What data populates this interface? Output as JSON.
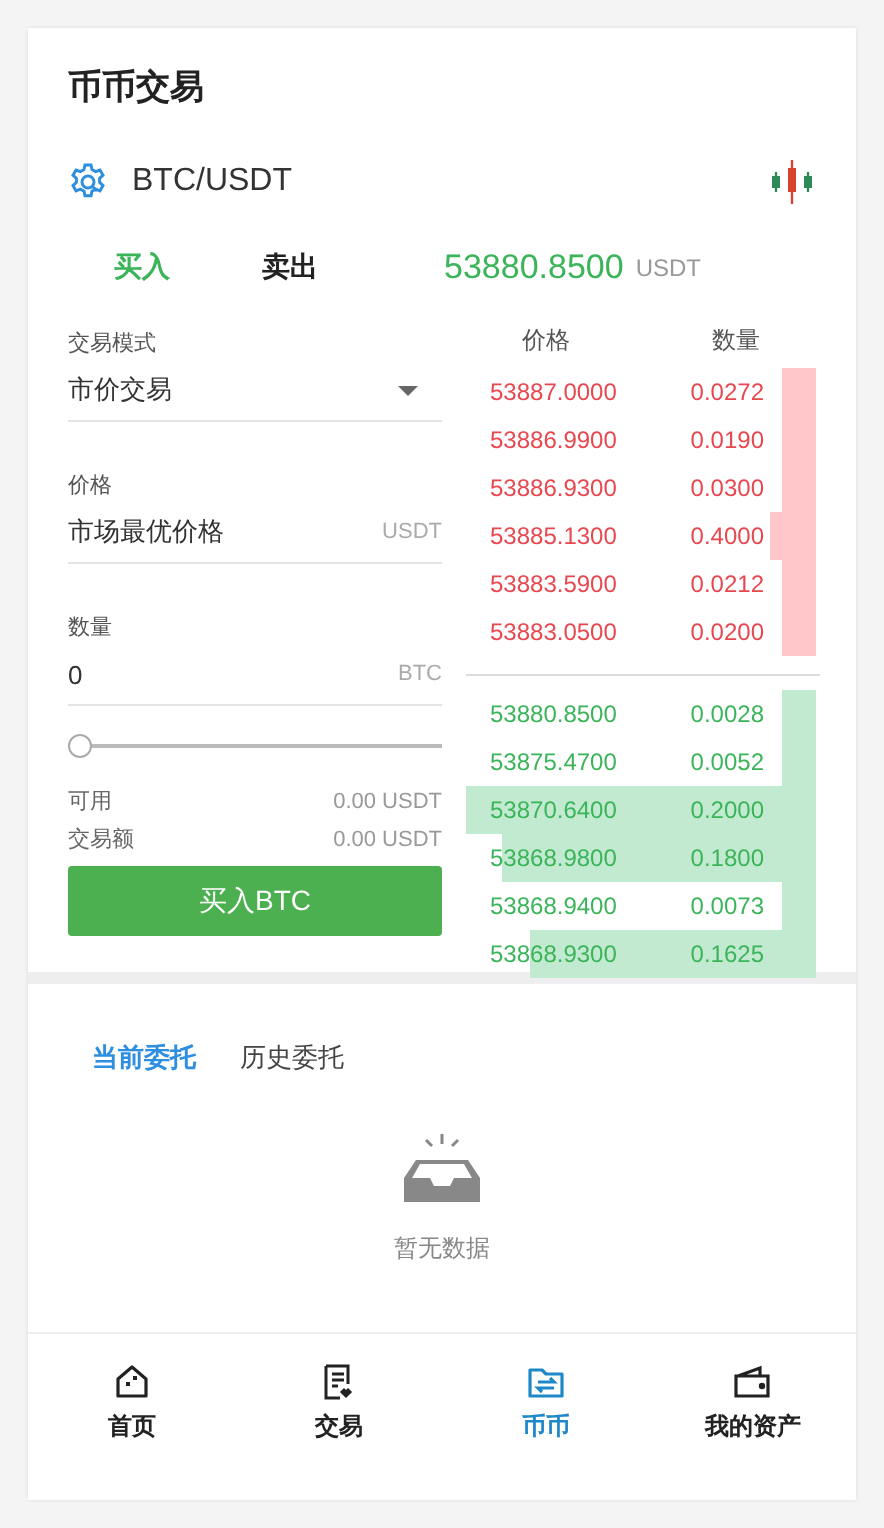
{
  "title": "币币交易",
  "pair": {
    "name": "BTC/USDT"
  },
  "side_tabs": [
    {
      "label": "买入",
      "selected": true
    },
    {
      "label": "卖出",
      "selected": false
    }
  ],
  "last_price": {
    "value": "53880.8500",
    "unit": "USDT"
  },
  "form": {
    "mode": {
      "label": "交易模式",
      "value": "市价交易"
    },
    "price": {
      "label": "价格",
      "value": "市场最优价格",
      "unit": "USDT"
    },
    "amount": {
      "label": "数量",
      "value": "0",
      "unit": "BTC"
    },
    "slider": {
      "level": 0
    },
    "available": {
      "label": "可用",
      "value": "0.00 USDT"
    },
    "turnover": {
      "label": "交易额",
      "value": "0.00 USDT"
    },
    "submit": "买入BTC"
  },
  "order_book": {
    "columns": [
      "价格",
      "数量"
    ],
    "asks": [
      {
        "price": "53887.0000",
        "amount": "0.0272",
        "level": 0.1
      },
      {
        "price": "53886.9900",
        "amount": "0.0190",
        "level": 0.1
      },
      {
        "price": "53886.9300",
        "amount": "0.0300",
        "level": 0.1
      },
      {
        "price": "53885.1300",
        "amount": "0.4000",
        "level": 0.13
      },
      {
        "price": "53883.5900",
        "amount": "0.0212",
        "level": 0.1
      },
      {
        "price": "53883.0500",
        "amount": "0.0200",
        "level": 0.1
      }
    ],
    "bids": [
      {
        "price": "53880.8500",
        "amount": "0.0028",
        "level": 0.1
      },
      {
        "price": "53875.4700",
        "amount": "0.0052",
        "level": 0.1
      },
      {
        "price": "53870.6400",
        "amount": "0.2000",
        "level": 1
      },
      {
        "price": "53868.9800",
        "amount": "0.1800",
        "level": 0.9
      },
      {
        "price": "53868.9400",
        "amount": "0.0073",
        "level": 0.1
      },
      {
        "price": "53868.9300",
        "amount": "0.1625",
        "level": 0.82
      }
    ]
  },
  "order_tabs": [
    {
      "label": "当前委托",
      "selected": true
    },
    {
      "label": "历史委托",
      "selected": false
    }
  ],
  "empty_text": "暂无数据",
  "nav": [
    {
      "label": "首页",
      "kind": "home",
      "selected": false
    },
    {
      "label": "交易",
      "kind": "trade",
      "selected": false
    },
    {
      "label": "币币",
      "kind": "exchange",
      "selected": true
    },
    {
      "label": "我的资产",
      "kind": "wallet",
      "selected": false
    }
  ]
}
